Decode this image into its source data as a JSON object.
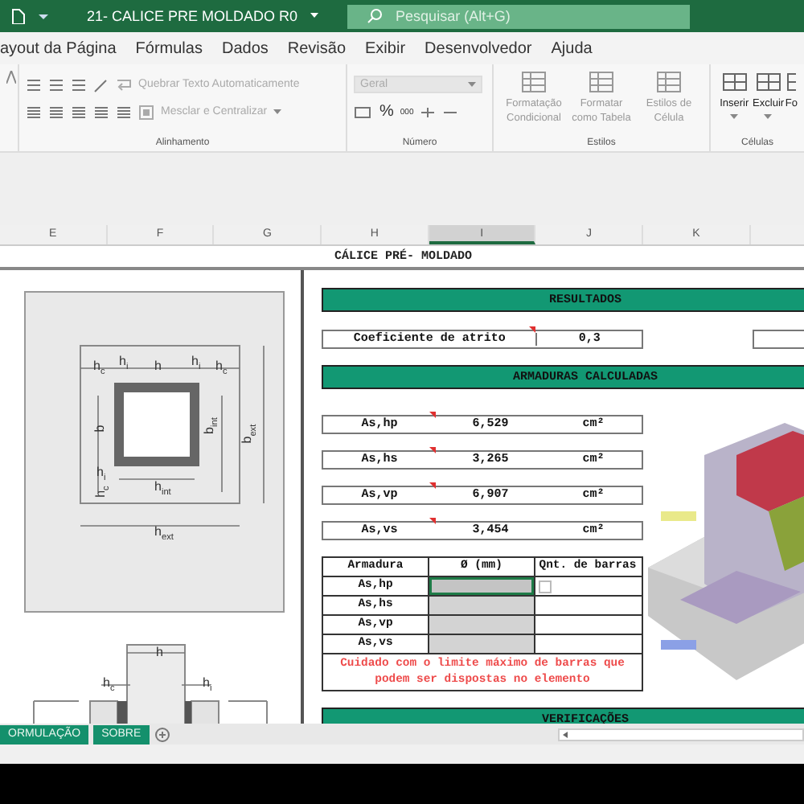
{
  "title_bar": {
    "file_name": "21- CALICE PRE MOLDADO R0",
    "search_placeholder": "Pesquisar (Alt+G)"
  },
  "menu": [
    "ayout da Página",
    "Fórmulas",
    "Dados",
    "Revisão",
    "Exibir",
    "Desenvolvedor",
    "Ajuda"
  ],
  "ribbon": {
    "alignment": {
      "label": "Alinhamento",
      "wrap": {
        "label": "Quebrar Texto Automaticamente",
        "disabled": true
      },
      "merge": {
        "label": "Mesclar e Centralizar",
        "disabled": true
      }
    },
    "number": {
      "label": "Número",
      "format": {
        "value": "Geral",
        "disabled": true
      },
      "percent": "%",
      "thousands": "000"
    },
    "styles": {
      "label": "Estilos",
      "buttons": [
        {
          "label": "Formatação Condicional",
          "disabled": true
        },
        {
          "label": "Formatar como Tabela",
          "disabled": true
        },
        {
          "label": "Estilos de Célula",
          "disabled": true
        }
      ]
    },
    "cells": {
      "label": "Células",
      "buttons": [
        {
          "label": "Inserir",
          "caret": true
        },
        {
          "label": "Excluir",
          "caret": true
        },
        {
          "label": "Fo",
          "caret": false
        }
      ]
    }
  },
  "columns": [
    {
      "label": "E",
      "selected": false
    },
    {
      "label": "F",
      "selected": false
    },
    {
      "label": "G",
      "selected": false
    },
    {
      "label": "H",
      "selected": false
    },
    {
      "label": "I",
      "selected": true
    },
    {
      "label": "J",
      "selected": false
    },
    {
      "label": "K",
      "selected": false
    }
  ],
  "sheet": {
    "title": "CÁLICE PRÉ- MOLDADO",
    "plan_labels": [
      "h$_{c}$",
      "h$_{i}$",
      "h",
      "h$_{i}$",
      "h$_{c}$",
      "b",
      "b$_{int}$",
      "b$_{ext}$",
      "h$_{i}$",
      "h$_{c}$",
      "h$_{int}$",
      "h$_{ext}$"
    ],
    "elevation_labels": [
      "h",
      "h$_{c}$",
      "h$_{i}$"
    ],
    "results_header": "RESULTADOS",
    "friction": {
      "label": "Coeficiente de atrito",
      "value": "0,3",
      "comment": true
    },
    "reinforcement_header": "ARMADURAS CALCULADAS",
    "areas": [
      {
        "label": "As,hp",
        "value": "6,529",
        "unit": "cm²",
        "comment": true
      },
      {
        "label": "As,hs",
        "value": "3,265",
        "unit": "cm²",
        "comment": true
      },
      {
        "label": "As,vp",
        "value": "6,907",
        "unit": "cm²",
        "comment": true
      },
      {
        "label": "As,vs",
        "value": "3,454",
        "unit": "cm²",
        "comment": true
      }
    ],
    "bar_table": {
      "columns": [
        "Armadura",
        "Ø (mm)",
        "Qnt. de barras"
      ],
      "rows": [
        {
          "label": "As,hp",
          "selected": true
        },
        {
          "label": "As,hs",
          "selected": false
        },
        {
          "label": "As,vp",
          "selected": false
        },
        {
          "label": "As,vs",
          "selected": false
        }
      ],
      "warning": "Cuidado com o limite máximo de barras que podem ser dispostas no elemento"
    },
    "checks_header": "VERIFICAÇÕES"
  },
  "sheet_tabs": [
    {
      "label": "ORMULAÇÃO",
      "selected": false
    },
    {
      "label": "SOBRE",
      "selected": false
    }
  ]
}
